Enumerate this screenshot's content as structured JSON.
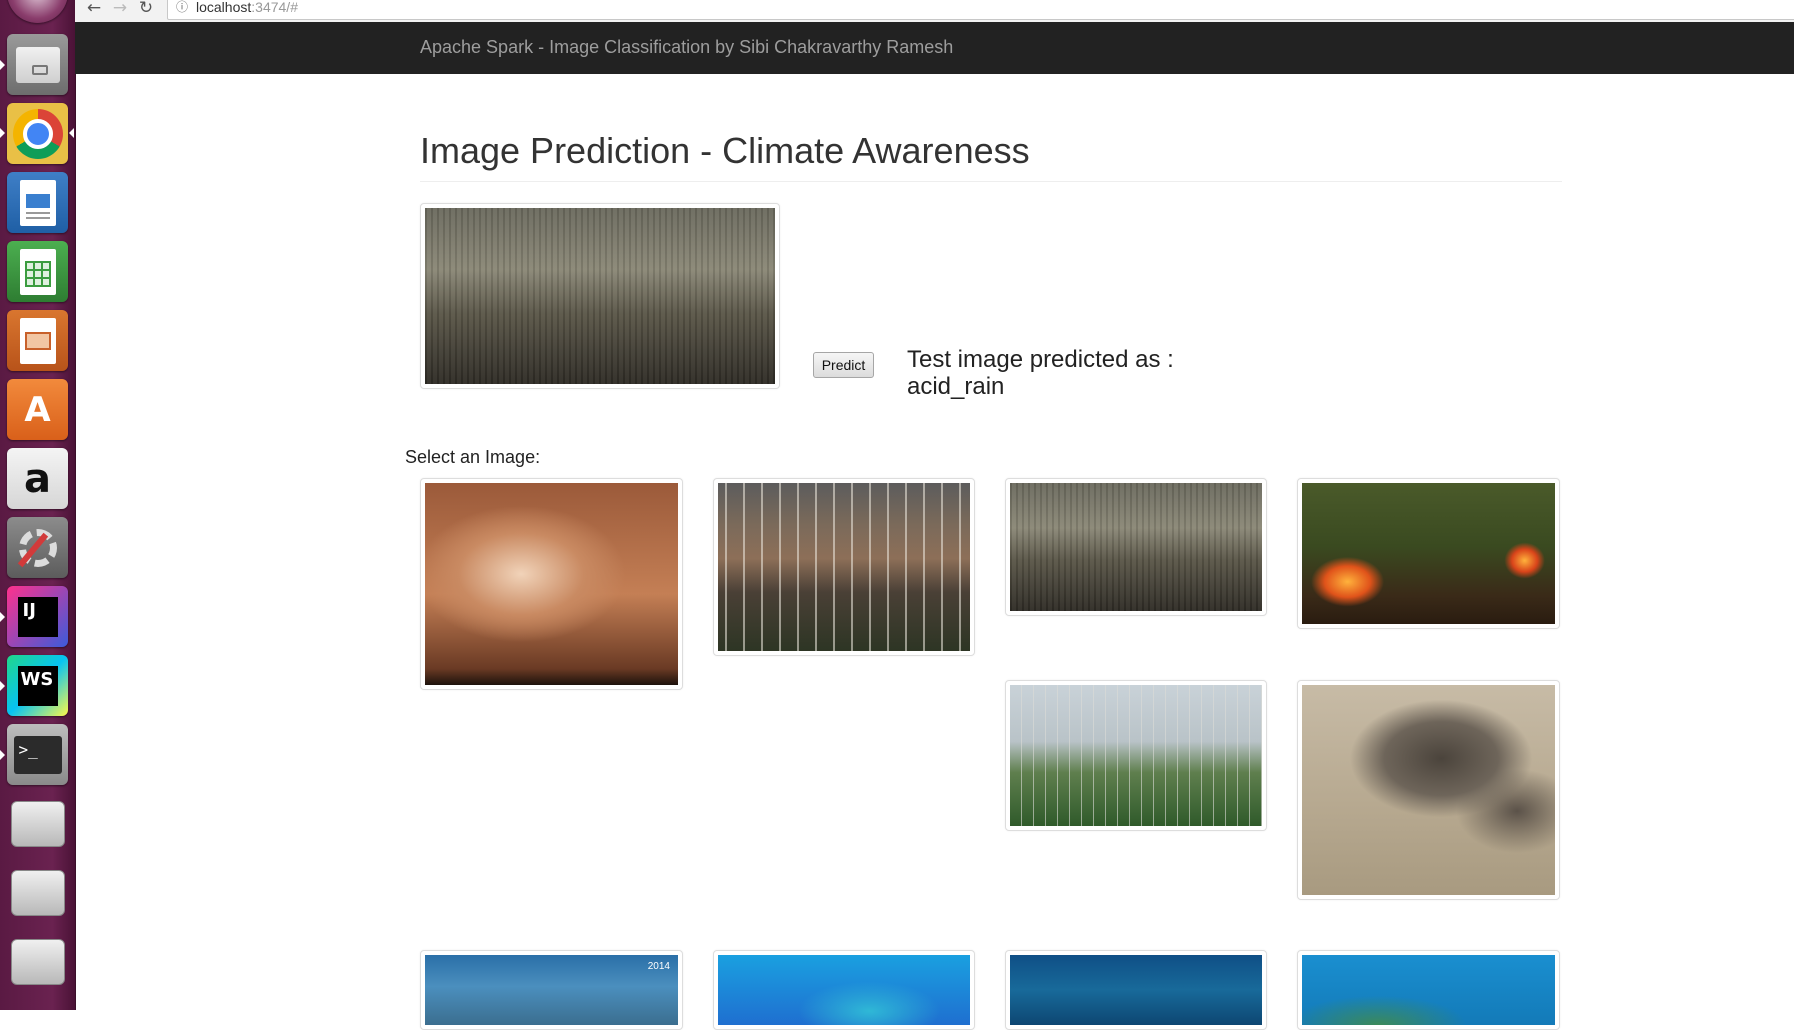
{
  "browser": {
    "url_host": "localhost",
    "url_rest": ":3474/#"
  },
  "navbar": {
    "brand": "Apache Spark - Image Classification by Sibi Chakravarthy Ramesh"
  },
  "main": {
    "title": "Image Prediction - Climate Awareness",
    "predict_button": "Predict",
    "prediction_label": "Test image predicted as :",
    "prediction_value": "acid_rain",
    "select_label": "Select an Image:"
  },
  "gallery_badges": {
    "year": "2014"
  },
  "launcher": {
    "icons": [
      "ubuntu-icon",
      "files-icon",
      "chrome-icon",
      "writer-icon",
      "calc-icon",
      "impress-icon",
      "software-center-icon",
      "amazon-icon",
      "settings-icon",
      "intellij-icon",
      "webstorm-icon",
      "terminal-icon",
      "drive-icon",
      "drive-icon",
      "drive-icon"
    ]
  },
  "colors": {
    "navbar_bg": "#222222",
    "navbar_text": "#9d9d9d",
    "launcher_bg": "#5a1a43"
  }
}
